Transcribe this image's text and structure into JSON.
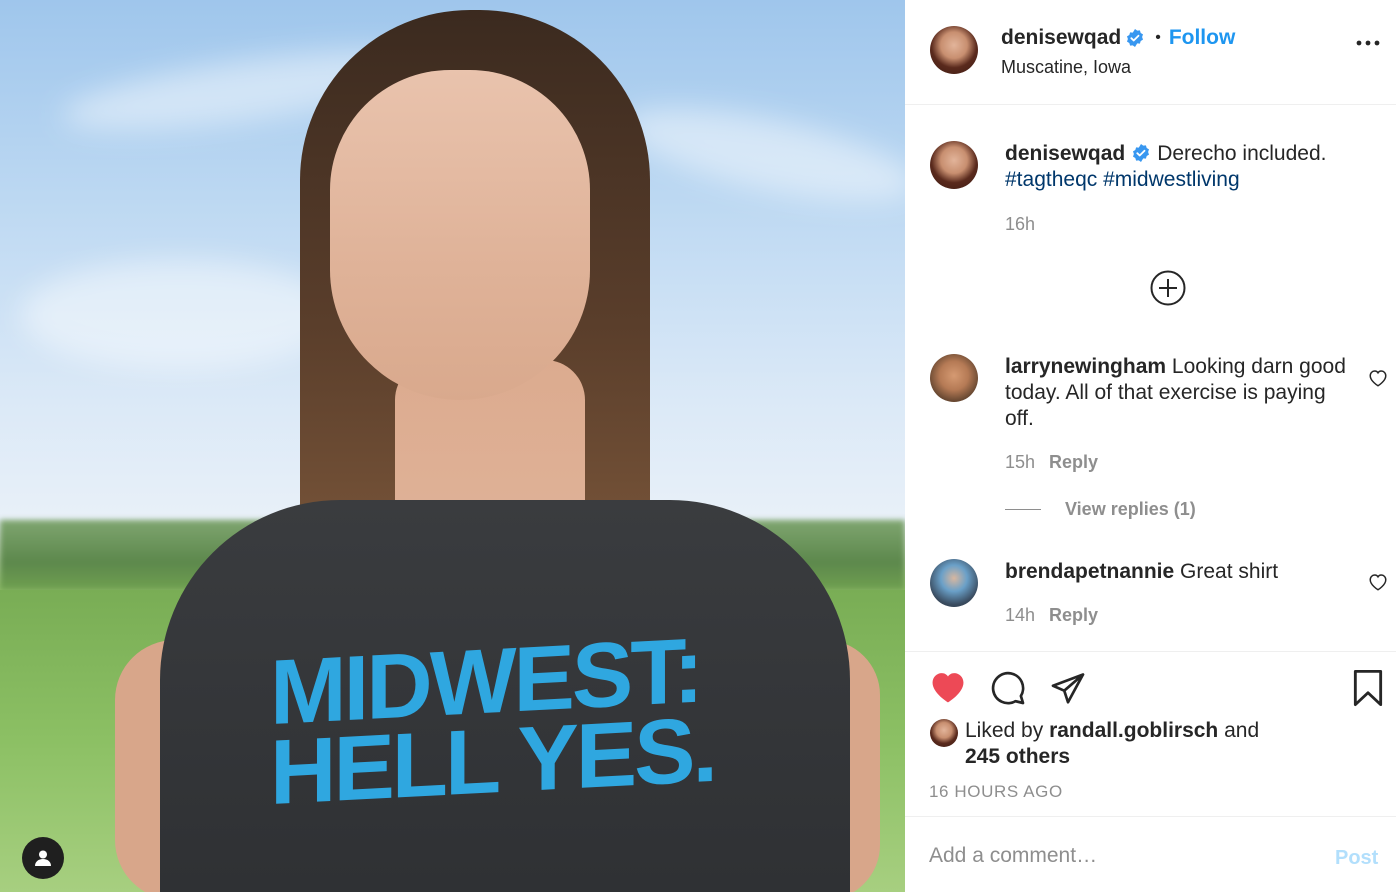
{
  "post": {
    "shirt_text": "MIDWEST:\nHELL YES."
  },
  "header": {
    "username": "denisewqad",
    "separator": "•",
    "follow_label": "Follow",
    "location": "Muscatine, Iowa"
  },
  "caption": {
    "username": "denisewqad",
    "text": "Derecho included.",
    "hashtags": [
      "#tagtheqc",
      "#midwestliving"
    ],
    "time": "16h"
  },
  "comments": [
    {
      "username": "larrynewingham",
      "text": "Looking darn good today. All of that exercise is paying off.",
      "time": "15h",
      "reply_label": "Reply",
      "view_replies": "View replies (1)"
    },
    {
      "username": "brendapetnannie",
      "text": "Great shirt",
      "time": "14h",
      "reply_label": "Reply"
    }
  ],
  "likes": {
    "prefix": "Liked by",
    "user": "randall.goblirsch",
    "conj": "and",
    "others": "245 others"
  },
  "time_ago": "16 HOURS AGO",
  "comment_box": {
    "placeholder": "Add a comment…",
    "post_label": "Post"
  },
  "colors": {
    "accent": "#1e96f0",
    "like": "#ed4956",
    "hashtag": "#00376b",
    "muted": "#8e8e8e",
    "post_disabled": "#b2dffc"
  },
  "icons": [
    "tag-user-icon",
    "verified-badge-icon",
    "more-options-icon",
    "load-more-icon",
    "heart-icon",
    "comment-icon",
    "share-icon",
    "bookmark-icon"
  ]
}
